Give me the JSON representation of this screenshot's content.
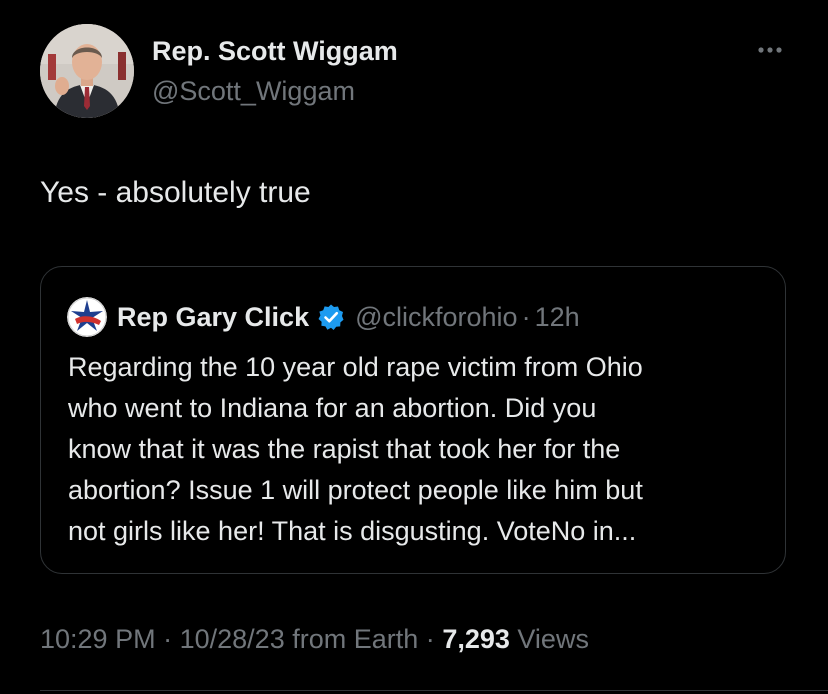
{
  "author": {
    "display_name": "Rep. Scott Wiggam",
    "handle": "@Scott_Wiggam"
  },
  "tweet": {
    "text": "Yes - absolutely true"
  },
  "quoted_tweet": {
    "display_name": "Rep Gary Click",
    "handle": "@clickforohio",
    "separator": "·",
    "time": "12h",
    "verified": true,
    "body_lines": [
      "Regarding the 10 year old rape victim from Ohio",
      "who went to Indiana for an abortion. Did you",
      "know that it was the rapist that took her for the",
      "abortion? Issue 1 will protect people like him but",
      "not girls like her!  That is disgusting. VoteNo in..."
    ]
  },
  "meta": {
    "time": "10:29 PM",
    "separator": "·",
    "date": "10/28/23",
    "source": "from Earth",
    "views_count": "7,293",
    "views_label": "Views"
  },
  "icons": {
    "more": "more-horizontal-icon",
    "verified": "verified-badge-icon"
  },
  "colors": {
    "background": "#000000",
    "primary_text": "#e7e9ea",
    "secondary_text": "#71767b",
    "border": "#2f3336",
    "verified_blue": "#1d9bf0"
  }
}
